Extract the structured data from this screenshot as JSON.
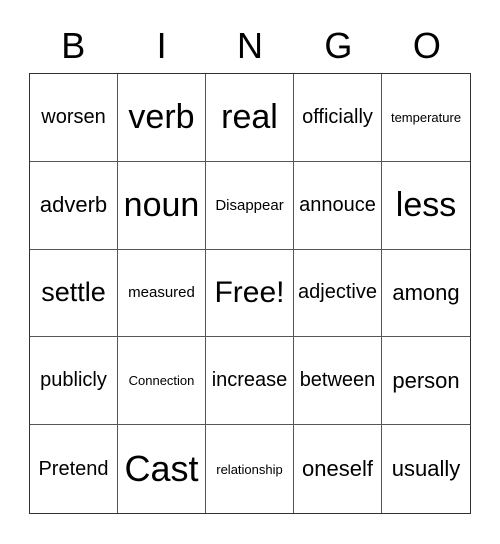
{
  "header": [
    "B",
    "I",
    "N",
    "G",
    "O"
  ],
  "cells": [
    {
      "text": "worsen",
      "size": "md"
    },
    {
      "text": "verb",
      "size": "xl"
    },
    {
      "text": "real",
      "size": "xl"
    },
    {
      "text": "officially",
      "size": "md"
    },
    {
      "text": "temperature",
      "size": "xs"
    },
    {
      "text": "adverb",
      "size": "lg"
    },
    {
      "text": "noun",
      "size": "xl"
    },
    {
      "text": "Disappear",
      "size": "sm"
    },
    {
      "text": "annouce",
      "size": "md"
    },
    {
      "text": "less",
      "size": "xl"
    },
    {
      "text": "settle",
      "size": "lg2"
    },
    {
      "text": "measured",
      "size": "sm"
    },
    {
      "text": "Free!",
      "size": "xl"
    },
    {
      "text": "adjective",
      "size": "md"
    },
    {
      "text": "among",
      "size": "lg"
    },
    {
      "text": "publicly",
      "size": "md"
    },
    {
      "text": "Connection",
      "size": "xs"
    },
    {
      "text": "increase",
      "size": "md"
    },
    {
      "text": "between",
      "size": "md"
    },
    {
      "text": "person",
      "size": "lg"
    },
    {
      "text": "Pretend",
      "size": "md"
    },
    {
      "text": "Cast",
      "size": "xxl"
    },
    {
      "text": "relationship",
      "size": "xs"
    },
    {
      "text": "oneself",
      "size": "lg"
    },
    {
      "text": "usually",
      "size": "lg"
    }
  ]
}
